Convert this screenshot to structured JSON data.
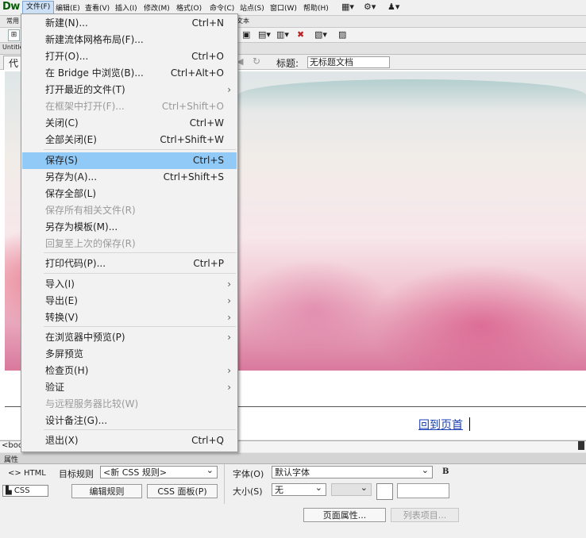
{
  "menubar": {
    "logo": "Dw",
    "items": [
      "文件(F)",
      "编辑(E)",
      "查看(V)",
      "插入(I)",
      "修改(M)",
      "格式(O)",
      "命令(C)",
      "站点(S)",
      "窗口(W)",
      "帮助(H)"
    ]
  },
  "tabs": {
    "insert_left": "常用",
    "insert_right": "文本",
    "doc_tab": "Untitle"
  },
  "doc_toolbar": {
    "code_btn": "代",
    "title_label": "标题:",
    "title_value": "无标题文档"
  },
  "file_menu": {
    "items": [
      {
        "label": "新建(N)...",
        "shortcut": "Ctrl+N",
        "disabled": false,
        "submenu": false
      },
      {
        "label": "新建流体网格布局(F)...",
        "shortcut": "",
        "disabled": false,
        "submenu": false
      },
      {
        "label": "打开(O)...",
        "shortcut": "Ctrl+O",
        "disabled": false,
        "submenu": false
      },
      {
        "label": "在 Bridge 中浏览(B)...",
        "shortcut": "Ctrl+Alt+O",
        "disabled": false,
        "submenu": false
      },
      {
        "label": "打开最近的文件(T)",
        "shortcut": "",
        "disabled": false,
        "submenu": true
      },
      {
        "label": "在框架中打开(F)...",
        "shortcut": "Ctrl+Shift+O",
        "disabled": true,
        "submenu": false
      },
      {
        "label": "关闭(C)",
        "shortcut": "Ctrl+W",
        "disabled": false,
        "submenu": false
      },
      {
        "label": "全部关闭(E)",
        "shortcut": "Ctrl+Shift+W",
        "disabled": false,
        "submenu": false
      },
      {
        "label": "保存(S)",
        "shortcut": "Ctrl+S",
        "disabled": false,
        "submenu": false,
        "highlighted": true
      },
      {
        "label": "另存为(A)...",
        "shortcut": "Ctrl+Shift+S",
        "disabled": false,
        "submenu": false
      },
      {
        "label": "保存全部(L)",
        "shortcut": "",
        "disabled": false,
        "submenu": false
      },
      {
        "label": "保存所有相关文件(R)",
        "shortcut": "",
        "disabled": true,
        "submenu": false
      },
      {
        "label": "另存为模板(M)...",
        "shortcut": "",
        "disabled": false,
        "submenu": false
      },
      {
        "label": "回复至上次的保存(R)",
        "shortcut": "",
        "disabled": true,
        "submenu": false
      },
      {
        "label": "打印代码(P)...",
        "shortcut": "Ctrl+P",
        "disabled": false,
        "submenu": false
      },
      {
        "label": "导入(I)",
        "shortcut": "",
        "disabled": false,
        "submenu": true
      },
      {
        "label": "导出(E)",
        "shortcut": "",
        "disabled": false,
        "submenu": true
      },
      {
        "label": "转换(V)",
        "shortcut": "",
        "disabled": false,
        "submenu": true
      },
      {
        "label": "在浏览器中预览(P)",
        "shortcut": "",
        "disabled": false,
        "submenu": true
      },
      {
        "label": "多屏预览",
        "shortcut": "",
        "disabled": false,
        "submenu": false
      },
      {
        "label": "检查页(H)",
        "shortcut": "",
        "disabled": false,
        "submenu": true
      },
      {
        "label": "验证",
        "shortcut": "",
        "disabled": false,
        "submenu": true
      },
      {
        "label": "与远程服务器比较(W)",
        "shortcut": "",
        "disabled": true,
        "submenu": false
      },
      {
        "label": "设计备注(G)...",
        "shortcut": "",
        "disabled": false,
        "submenu": false
      },
      {
        "label": "退出(X)",
        "shortcut": "Ctrl+Q",
        "disabled": false,
        "submenu": false
      }
    ]
  },
  "canvas": {
    "back_to_top_link": "回到页首"
  },
  "status": {
    "tag_path": "<bod"
  },
  "properties": {
    "panel_title": "属性",
    "html_tab": "HTML",
    "css_tab": "CSS",
    "target_rule_label": "目标规则",
    "target_rule_value": "<新 CSS 规则>",
    "edit_rule_button": "编辑规则",
    "css_panel_button": "CSS 面板(P)",
    "font_label": "字体(O)",
    "font_value": "默认字体",
    "bold_button": "B",
    "size_label": "大小(S)",
    "size_value": "无",
    "page_properties_button": "页面属性...",
    "list_item_button": "列表项目..."
  }
}
